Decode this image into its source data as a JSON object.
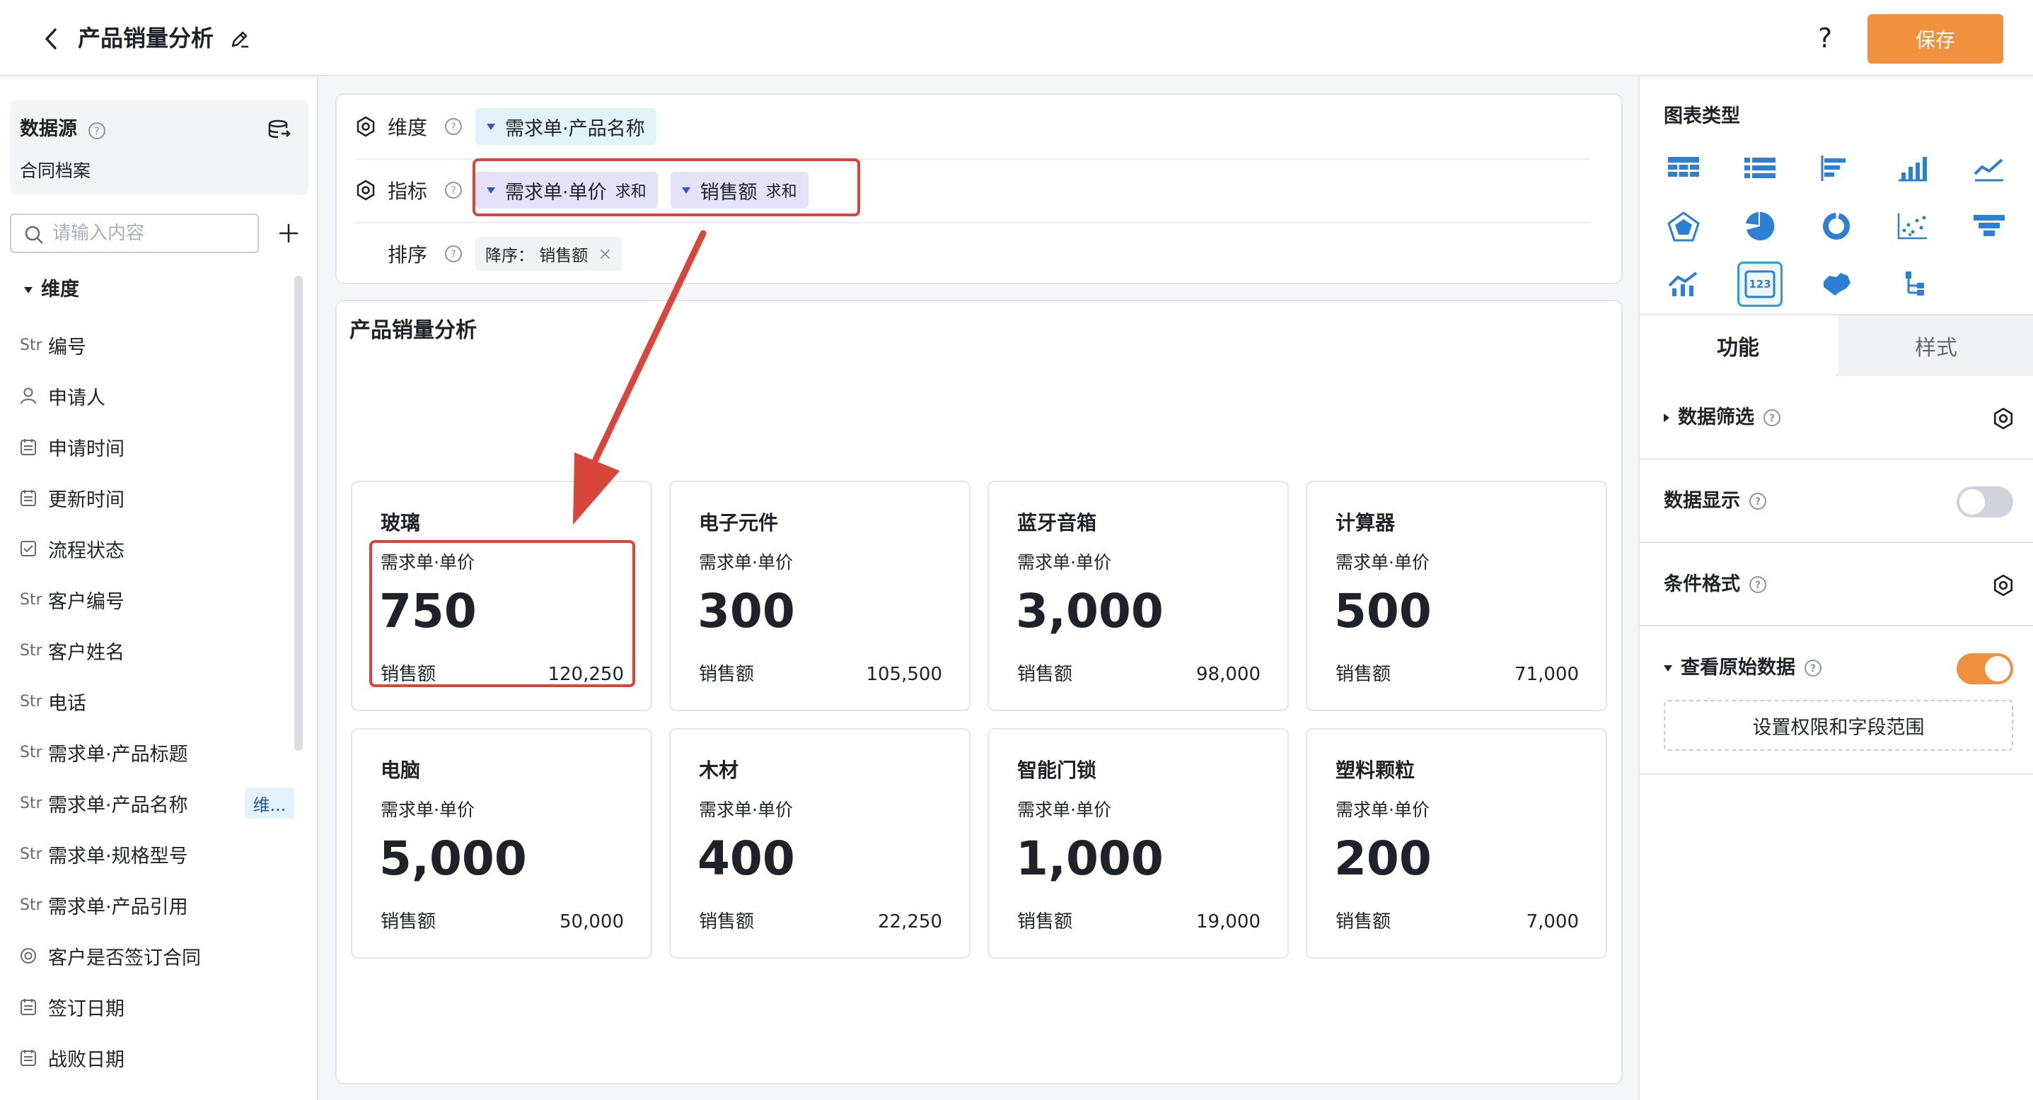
{
  "header": {
    "title": "产品销量分析",
    "help_label": "?",
    "save_label": "保存"
  },
  "datasource": {
    "label": "数据源",
    "name": "合同档案"
  },
  "search": {
    "placeholder": "请输入内容"
  },
  "field_group": {
    "label": "维度"
  },
  "fields": [
    {
      "type": "Str",
      "label": "编号",
      "icon": "text-type-icon"
    },
    {
      "type": "",
      "label": "申请人",
      "icon": "user-icon"
    },
    {
      "type": "",
      "label": "申请时间",
      "icon": "calendar-icon"
    },
    {
      "type": "",
      "label": "更新时间",
      "icon": "calendar-icon"
    },
    {
      "type": "",
      "label": "流程状态",
      "icon": "checkbox-icon"
    },
    {
      "type": "Str",
      "label": "客户编号",
      "icon": "text-type-icon"
    },
    {
      "type": "Str",
      "label": "客户姓名",
      "icon": "text-type-icon"
    },
    {
      "type": "Str",
      "label": "电话",
      "icon": "text-type-icon"
    },
    {
      "type": "Str",
      "label": "需求单·产品标题",
      "icon": "text-type-icon"
    },
    {
      "type": "Str",
      "label": "需求单·产品名称",
      "icon": "text-type-icon",
      "tag": "维..."
    },
    {
      "type": "Str",
      "label": "需求单·规格型号",
      "icon": "text-type-icon"
    },
    {
      "type": "Str",
      "label": "需求单·产品引用",
      "icon": "text-type-icon"
    },
    {
      "type": "",
      "label": "客户是否签订合同",
      "icon": "radio-icon"
    },
    {
      "type": "",
      "label": "签订日期",
      "icon": "calendar-icon"
    },
    {
      "type": "",
      "label": "战败日期",
      "icon": "calendar-icon"
    }
  ],
  "config": {
    "dimension_label": "维度",
    "dimension_pill": "需求单·产品名称",
    "metric_label": "指标",
    "metrics": [
      {
        "name": "需求单·单价",
        "agg": "求和"
      },
      {
        "name": "销售额",
        "agg": "求和"
      }
    ],
    "sort_label": "排序",
    "sort_pill": "降序： 销售额",
    "sort_close": "×"
  },
  "chart_title": "产品销量分析",
  "chart_data": {
    "type": "table",
    "title": "产品销量分析",
    "primary_metric_label": "需求单·单价",
    "secondary_metric_label": "销售额",
    "cards": [
      {
        "name": "玻璃",
        "value": "750",
        "sales": "120,250"
      },
      {
        "name": "电子元件",
        "value": "300",
        "sales": "105,500"
      },
      {
        "name": "蓝牙音箱",
        "value": "3,000",
        "sales": "98,000"
      },
      {
        "name": "计算器",
        "value": "500",
        "sales": "71,000"
      },
      {
        "name": "电脑",
        "value": "5,000",
        "sales": "50,000"
      },
      {
        "name": "木材",
        "value": "400",
        "sales": "22,250"
      },
      {
        "name": "智能门锁",
        "value": "1,000",
        "sales": "19,000"
      },
      {
        "name": "塑料颗粒",
        "value": "200",
        "sales": "7,000"
      }
    ]
  },
  "right_panel": {
    "chart_type_label": "图表类型",
    "chart_types": [
      "table-icon",
      "list-icon",
      "horizontal-bar-icon",
      "bar-chart-icon",
      "line-chart-icon",
      "radar-icon",
      "pie-icon",
      "donut-icon",
      "scatter-icon",
      "funnel-icon",
      "combo-chart-icon",
      "kpi-card-icon",
      "map-icon",
      "tree-icon"
    ],
    "selected_chart_type": "kpi-card-icon",
    "tabs": [
      "功能",
      "样式"
    ],
    "settings": {
      "data_filter": "数据筛选",
      "data_display": "数据显示",
      "data_display_on": false,
      "conditional_format": "条件格式",
      "view_raw": "查看原始数据",
      "view_raw_on": true,
      "permission_button": "设置权限和字段范围"
    }
  },
  "colors": {
    "accent": "#f0913f",
    "highlight_red": "#d9443b",
    "selected_blue": "#2d9cdb"
  }
}
